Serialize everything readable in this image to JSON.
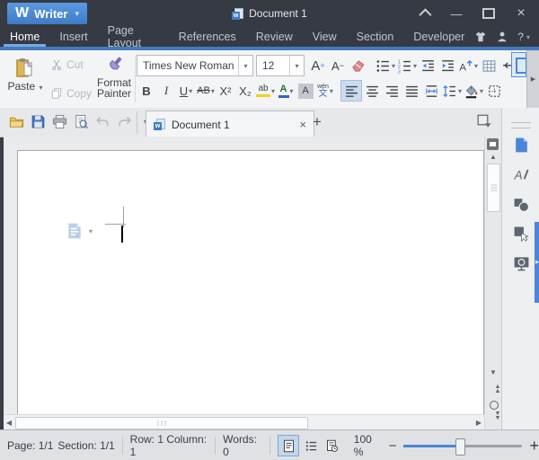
{
  "window": {
    "app_name": "Writer",
    "app_logo": "W",
    "document_title": "Document 1"
  },
  "menubar": {
    "tabs": [
      "Home",
      "Insert",
      "Page Layout",
      "References",
      "Review",
      "View",
      "Section",
      "Developer"
    ],
    "help_label": "?"
  },
  "ribbon": {
    "paste_label": "Paste",
    "cut_label": "Cut",
    "copy_label": "Copy",
    "format_painter_line1": "Format",
    "format_painter_line2": "Painter",
    "font_name": "Times New Roman",
    "font_size": "12",
    "grow_font": "A",
    "grow_sign": "+",
    "shrink_font": "A",
    "shrink_sign": "−",
    "bold": "B",
    "italic": "I",
    "underline": "U",
    "strikethrough": "AB",
    "superscript": "X²",
    "subscript": "X₂",
    "highlight_label": "ab",
    "font_color_label": "A",
    "char_shading_label": "A",
    "phonetic_top": "wén",
    "phonetic_bottom": "文"
  },
  "tabbar": {
    "active_tab_title": "Document 1",
    "new_tab_glyph": "+"
  },
  "statusbar": {
    "page": "Page: 1/1",
    "section": "Section: 1/1",
    "row_column": "Row: 1 Column: 1",
    "words": "Words: 0",
    "zoom_value": "100 %",
    "zoom_minus": "−",
    "zoom_plus": "+"
  },
  "colors": {
    "accent_blue": "#4a86d8",
    "titlebar_bg": "#363a42",
    "ribbon_bg": "#f3f4f5",
    "active_underline": "#74abe2"
  }
}
